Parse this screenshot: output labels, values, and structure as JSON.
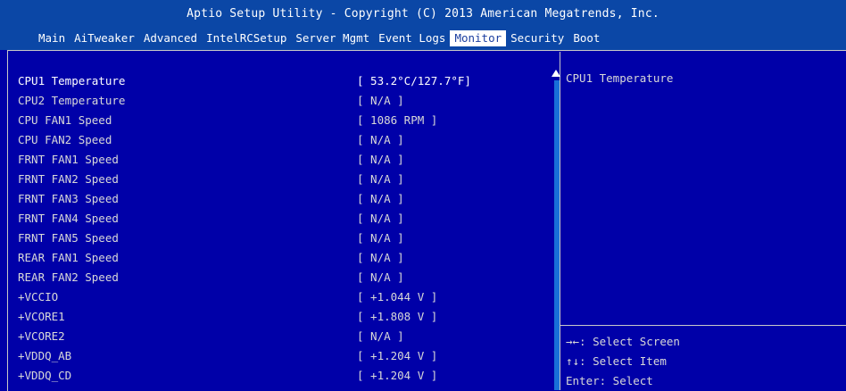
{
  "title": "Aptio Setup Utility - Copyright (C) 2013 American Megatrends, Inc.",
  "menu": [
    {
      "label": "Main",
      "active": false
    },
    {
      "label": "AiTweaker",
      "active": false
    },
    {
      "label": "Advanced",
      "active": false
    },
    {
      "label": "IntelRCSetup",
      "active": false
    },
    {
      "label": "Server Mgmt",
      "active": false
    },
    {
      "label": "Event Logs",
      "active": false
    },
    {
      "label": "Monitor",
      "active": true
    },
    {
      "label": "Security",
      "active": false
    },
    {
      "label": "Boot",
      "active": false
    }
  ],
  "items": [
    {
      "label": "CPU1 Temperature",
      "value": "[ 53.2°C/127.7°F]"
    },
    {
      "label": "CPU2 Temperature",
      "value": "[ N/A ]"
    },
    {
      "label": "CPU FAN1 Speed",
      "value": "[ 1086 RPM ]"
    },
    {
      "label": "CPU FAN2 Speed",
      "value": "[ N/A ]"
    },
    {
      "label": "FRNT FAN1 Speed",
      "value": "[ N/A ]"
    },
    {
      "label": "FRNT FAN2 Speed",
      "value": "[ N/A ]"
    },
    {
      "label": "FRNT FAN3 Speed",
      "value": "[ N/A ]"
    },
    {
      "label": "FRNT FAN4 Speed",
      "value": "[ N/A ]"
    },
    {
      "label": "FRNT FAN5 Speed",
      "value": "[ N/A ]"
    },
    {
      "label": "REAR FAN1 Speed",
      "value": "[ N/A ]"
    },
    {
      "label": "REAR FAN2 Speed",
      "value": "[ N/A ]"
    },
    {
      "label": "+VCCIO",
      "value": "[ +1.044 V ]"
    },
    {
      "label": "+VCORE1",
      "value": "[ +1.808 V ]"
    },
    {
      "label": "+VCORE2",
      "value": "[ N/A ]"
    },
    {
      "label": "+VDDQ_AB",
      "value": "[ +1.204 V ]"
    },
    {
      "label": "+VDDQ_CD",
      "value": "[ +1.204 V ]"
    }
  ],
  "selected_item": "CPU1 Temperature",
  "help": {
    "title": "CPU1 Temperature",
    "keys": [
      "→←: Select Screen",
      "↑↓: Select Item",
      "Enter: Select"
    ]
  },
  "colors": {
    "background": "#0000a8",
    "title_bar": "#0b47a6",
    "active_tab_bg": "#ffffff",
    "scrollbar": "#1870d8"
  }
}
